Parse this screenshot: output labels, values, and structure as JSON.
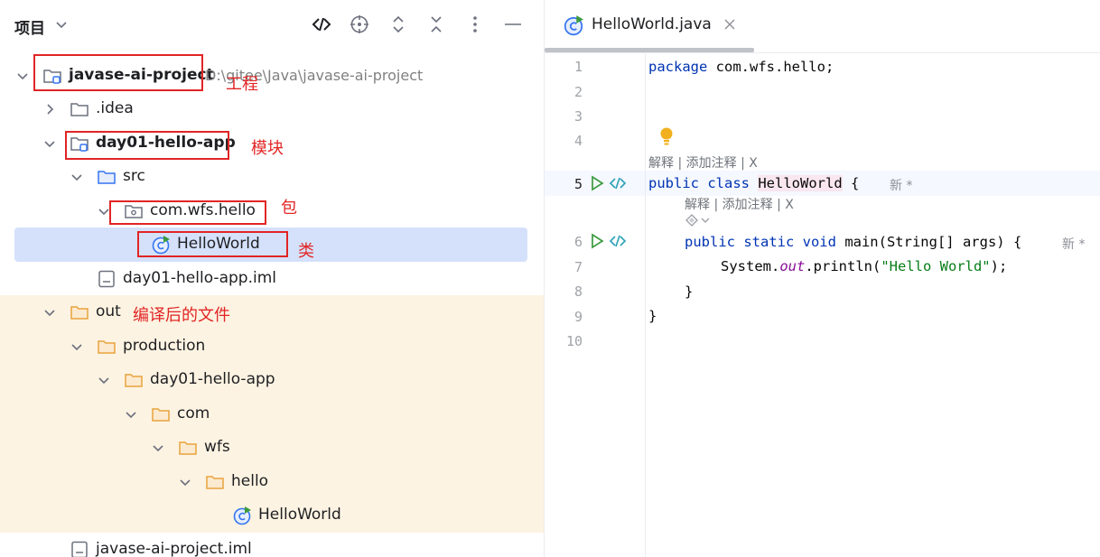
{
  "panel": {
    "title": "项目"
  },
  "tree": {
    "root": {
      "label": "javase-ai-project",
      "path": "D:\\gitee\\Java\\javase-ai-project",
      "annotation": "工程"
    },
    "idea": {
      "label": ".idea"
    },
    "module": {
      "label": "day01-hello-app",
      "annotation": "模块"
    },
    "src": {
      "label": "src"
    },
    "package": {
      "label": "com.wfs.hello",
      "annotation": "包"
    },
    "class": {
      "label": "HelloWorld",
      "annotation": "类"
    },
    "module_iml": {
      "label": "day01-hello-app.iml"
    },
    "out": {
      "label": "out",
      "annotation": "编译后的文件"
    },
    "production": {
      "label": "production"
    },
    "out_module": {
      "label": "day01-hello-app"
    },
    "com": {
      "label": "com"
    },
    "wfs": {
      "label": "wfs"
    },
    "hello": {
      "label": "hello"
    },
    "out_class": {
      "label": "HelloWorld"
    },
    "project_iml": {
      "label": "javase-ai-project.iml"
    }
  },
  "editor": {
    "tab_label": "HelloWorld.java",
    "line_numbers": [
      "1",
      "2",
      "3",
      "4",
      "5",
      "6",
      "7",
      "8",
      "9",
      "10"
    ],
    "code": {
      "l1_kw": "package",
      "l1_rest": " com.wfs.hello;",
      "l5_kw": "public class",
      "l5_cls": "HelloWorld",
      "l5_rest": " {",
      "l6_kw": "public static void",
      "l6_rest": " main(String[] args) {",
      "l7_a": "System.",
      "l7_field": "out",
      "l7_b": ".println(",
      "l7_str": "\"Hello World\"",
      "l7_c": ");",
      "l8": "}",
      "l9": "}"
    },
    "hint_top": "解释 | 添加注释 | X",
    "hint_inner": "解释 | 添加注释 | X",
    "new_label": "新 *",
    "new_label2": "新 *"
  },
  "colors": {
    "accent": "#3574f0",
    "annotation_red": "#e12525",
    "selection": "#d5e1fb",
    "output_highlight": "#fdf3e2",
    "folder_orange": "#e8a33d",
    "run_green": "#3c9a3f"
  }
}
